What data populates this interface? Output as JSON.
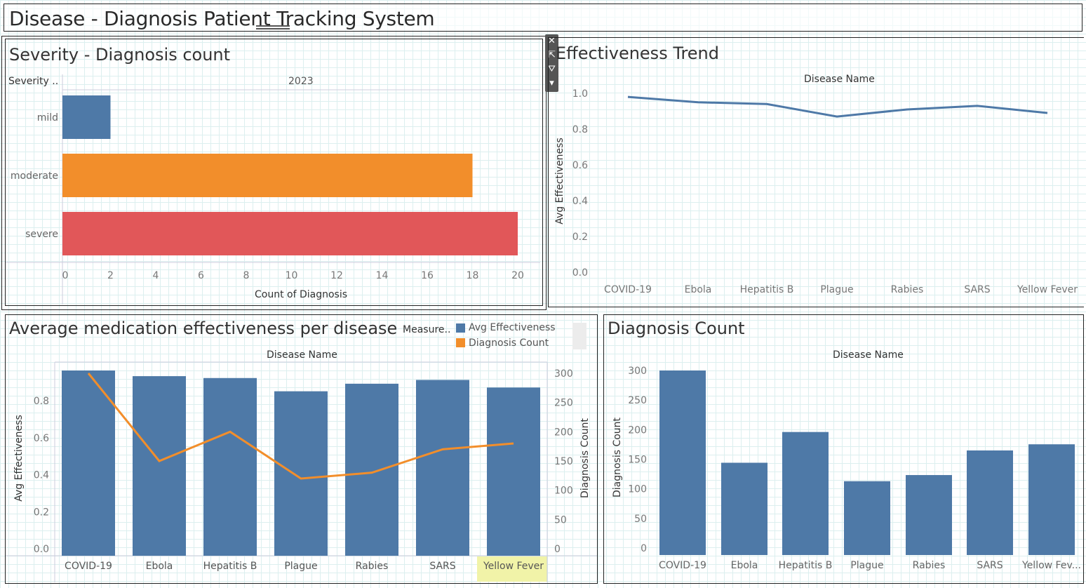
{
  "dashboard": {
    "title": "Disease - Diagnosis Patient Tracking System"
  },
  "toolbar": {
    "icons": [
      "close-icon",
      "popout-icon",
      "filter-icon",
      "more-icon"
    ]
  },
  "colors": {
    "blue": "#4e79a7",
    "orange": "#f28e2b",
    "red": "#e15759",
    "grid": "#dcefef"
  },
  "severity_panel": {
    "title": "Severity - Diagnosis count",
    "row_header": "Severity ..",
    "column_header": "2023",
    "xlabel": "Count of Diagnosis"
  },
  "trend_panel": {
    "title": "Effectiveness Trend",
    "column_header": "Disease Name",
    "ylabel": "Avg Effectiveness"
  },
  "combo_panel": {
    "title": "Average medication effectiveness per disease",
    "column_header": "Disease Name",
    "ylabel_left": "Avg Effectiveness",
    "ylabel_right": "Diagnosis Count",
    "legend_title": "Measure..",
    "legend_items": [
      {
        "label": "Avg Effectiveness",
        "color": "#4e79a7"
      },
      {
        "label": "Diagnosis Count",
        "color": "#f28e2b"
      }
    ],
    "highlighted_category": "Yellow Fever"
  },
  "count_panel": {
    "title": "Diagnosis Count",
    "column_header": "Disease Name",
    "ylabel": "Diagnosis Count"
  },
  "chart_data": [
    {
      "type": "bar",
      "orientation": "horizontal",
      "title": "Severity - Diagnosis count",
      "categories": [
        "mild",
        "moderate",
        "severe"
      ],
      "values": [
        2,
        18,
        20
      ],
      "colors": [
        "#4e79a7",
        "#f28e2b",
        "#e15759"
      ],
      "xlabel": "Count of Diagnosis",
      "xlim": [
        0,
        21
      ],
      "xticks": [
        0,
        2,
        4,
        6,
        8,
        10,
        12,
        14,
        16,
        18,
        20
      ]
    },
    {
      "type": "line",
      "title": "Effectiveness Trend",
      "categories": [
        "COVID-19",
        "Ebola",
        "Hepatitis B",
        "Plague",
        "Rabies",
        "SARS",
        "Yellow Fever"
      ],
      "values": [
        0.98,
        0.95,
        0.94,
        0.87,
        0.91,
        0.93,
        0.89
      ],
      "ylabel": "Avg Effectiveness",
      "ylim": [
        0,
        1.0
      ],
      "yticks": [
        "0.0",
        "0.2",
        "0.4",
        "0.6",
        "0.8",
        "1.0"
      ]
    },
    {
      "type": "bar",
      "title": "Average medication effectiveness per disease",
      "categories": [
        "COVID-19",
        "Ebola",
        "Hepatitis B",
        "Plague",
        "Rabies",
        "SARS",
        "Yellow Fever"
      ],
      "series": [
        {
          "name": "Avg Effectiveness",
          "type": "bar",
          "axis": "left",
          "values": [
            0.98,
            0.95,
            0.94,
            0.87,
            0.91,
            0.93,
            0.89
          ]
        },
        {
          "name": "Diagnosis Count",
          "type": "line",
          "axis": "right",
          "values": [
            300,
            150,
            200,
            120,
            130,
            170,
            180
          ]
        }
      ],
      "ylim_left": [
        0,
        0.98
      ],
      "yticks_left": [
        "0.0",
        "0.2",
        "0.4",
        "0.6",
        "0.8"
      ],
      "ylim_right": [
        0,
        300
      ],
      "yticks_right": [
        "0",
        "50",
        "100",
        "150",
        "200",
        "250",
        "300"
      ]
    },
    {
      "type": "bar",
      "title": "Diagnosis Count",
      "categories": [
        "COVID-19",
        "Ebola",
        "Hepatitis B",
        "Plague",
        "Rabies",
        "SARS",
        "Yellow Fev..."
      ],
      "values": [
        300,
        150,
        200,
        120,
        130,
        170,
        180
      ],
      "ylabel": "Diagnosis Count",
      "ylim": [
        0,
        300
      ],
      "yticks": [
        "0",
        "50",
        "100",
        "150",
        "200",
        "250",
        "300"
      ]
    }
  ]
}
